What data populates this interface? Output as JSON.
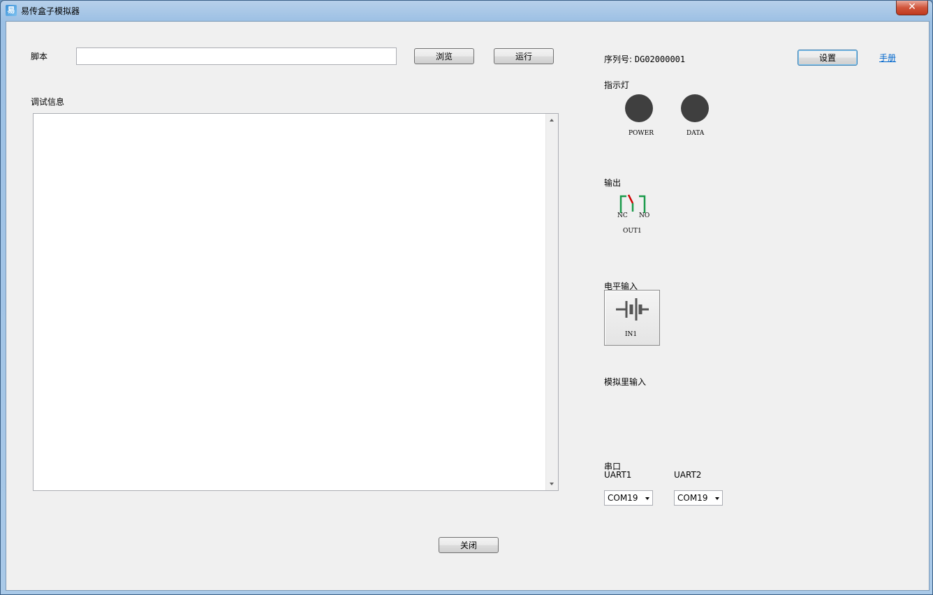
{
  "window": {
    "title": "易传盒子模拟器",
    "close_label": "✕",
    "icon_glyph": "易"
  },
  "script": {
    "label": "脚本",
    "value": "",
    "browse_label": "浏览",
    "run_label": "运行"
  },
  "debug": {
    "label": "调试信息",
    "content": ""
  },
  "device": {
    "serial_label": "序列号:",
    "serial_value": "DG02000001",
    "settings_label": "设置",
    "manual_label": "手册"
  },
  "indicators": {
    "label": "指示灯",
    "items": [
      {
        "name": "POWER",
        "color": "#3f3f3f"
      },
      {
        "name": "DATA",
        "color": "#3f3f3f"
      }
    ]
  },
  "output": {
    "label": "输出",
    "relay": {
      "nc": "NC",
      "no": "NO",
      "name": "OUT1",
      "contact_color": "#cc0000",
      "terminal_color": "#1a9a4a"
    }
  },
  "level_input": {
    "label": "电平输入",
    "name": "IN1"
  },
  "analog_input": {
    "label": "模拟里输入"
  },
  "serial": {
    "label": "串口",
    "uart1": {
      "label": "UART1",
      "value": "COM19"
    },
    "uart2": {
      "label": "UART2",
      "value": "COM19"
    }
  },
  "footer": {
    "close_label": "关闭"
  }
}
